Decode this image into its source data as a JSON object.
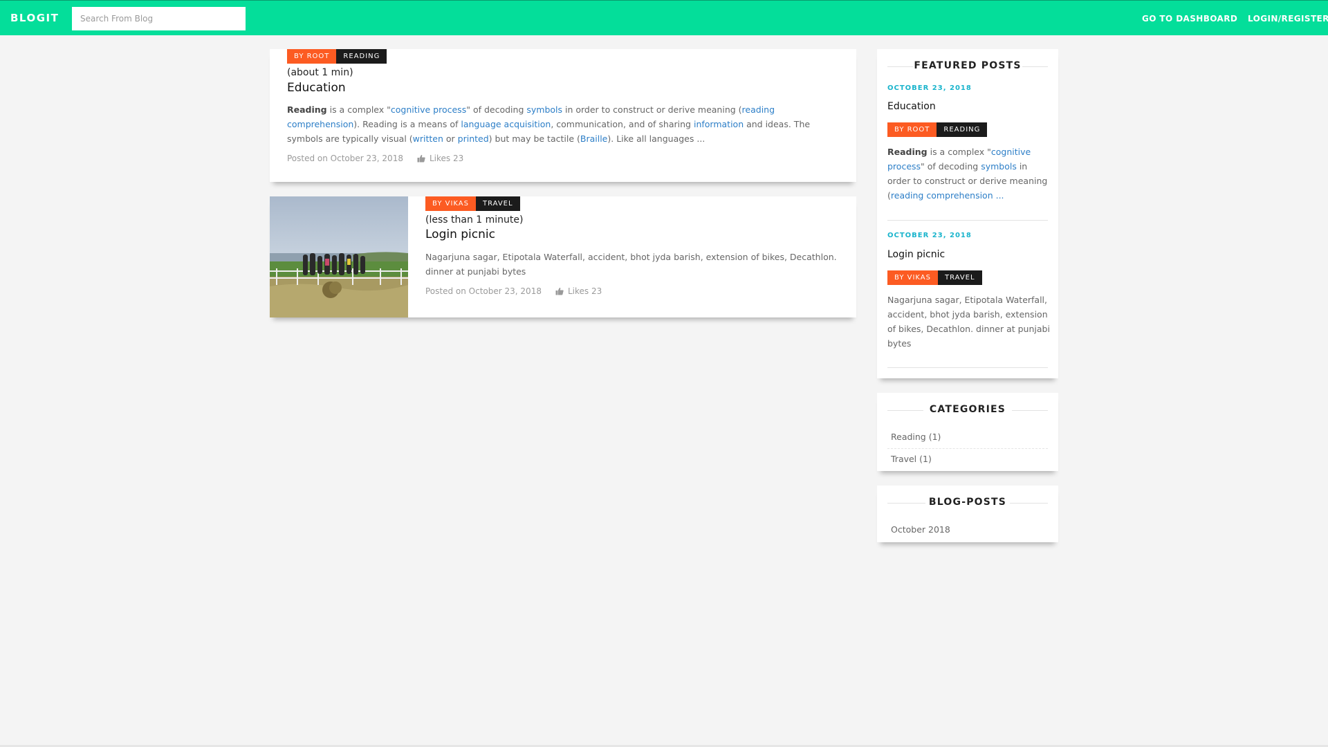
{
  "navbar": {
    "brand": "BLOGIT",
    "search_placeholder": "Search From Blog",
    "dashboard_label": "GO TO DASHBOARD",
    "login_label": "LOGIN/REGISTER",
    "color": "#04de9a"
  },
  "posts": [
    {
      "author_tag": "BY ROOT",
      "category_tag": "READING",
      "read_time": "(about 1 min)",
      "title": "Education",
      "excerpt": {
        "bold": "Reading",
        "t1": " is a complex \"",
        "l1": "cognitive process",
        "t2": "\" of decoding ",
        "l2": "symbols",
        "t3": " in order to construct or derive meaning (",
        "l3": "reading comprehension",
        "t4": "). Reading is a means of ",
        "l4": "language acquisition",
        "t5": ", communication, and of sharing ",
        "l5": "information",
        "t6": " and ideas. The symbols are typically visual (",
        "l6": "written",
        "t7": " or ",
        "l7": "printed",
        "t8": ") but may be tactile (",
        "l8": "Braille",
        "t9": "). Like all languages ..."
      },
      "posted_on": "Posted on October 23, 2018",
      "likes": "Likes 23"
    },
    {
      "author_tag": "BY VIKAS",
      "category_tag": "TRAVEL",
      "read_time": "(less than 1 minute)",
      "title": "Login picnic",
      "excerpt": "Nagarjuna sagar, Etipotala Waterfall, accident, bhot jyda barish, extension of bikes, Decathlon. dinner at punjabi bytes",
      "posted_on": "Posted on October 23, 2018",
      "likes": "Likes 23"
    }
  ],
  "sidebar": {
    "featured": {
      "title": "FEATURED POSTS",
      "items": [
        {
          "date": "OCTOBER 23, 2018",
          "title": "Education",
          "author_tag": "BY ROOT",
          "category_tag": "READING",
          "excerpt": {
            "bold": "Reading",
            "t1": " is a complex \"",
            "l1": "cognitive process",
            "t2": "\" of decoding ",
            "l2": "symbols",
            "t3": " in order to construct or derive meaning (",
            "l3": "reading comprehension ..."
          }
        },
        {
          "date": "OCTOBER 23, 2018",
          "title": "Login picnic",
          "author_tag": "BY VIKAS",
          "category_tag": "TRAVEL",
          "excerpt": "Nagarjuna sagar, Etipotala Waterfall, accident, bhot jyda barish, extension of bikes, Decathlon. dinner at punjabi bytes"
        }
      ]
    },
    "categories": {
      "title": "CATEGORIES",
      "items": [
        "Reading (1)",
        "Travel (1)"
      ]
    },
    "blogposts": {
      "title": "BLOG-POSTS",
      "items": [
        "October 2018"
      ]
    }
  },
  "colors": {
    "author_tag": "#fc5b22",
    "category_tag": "#1b1b1b",
    "link": "#2c7ec7",
    "date": "#1ab4cc"
  },
  "icons": {
    "likes": "thumbs-up-icon"
  }
}
